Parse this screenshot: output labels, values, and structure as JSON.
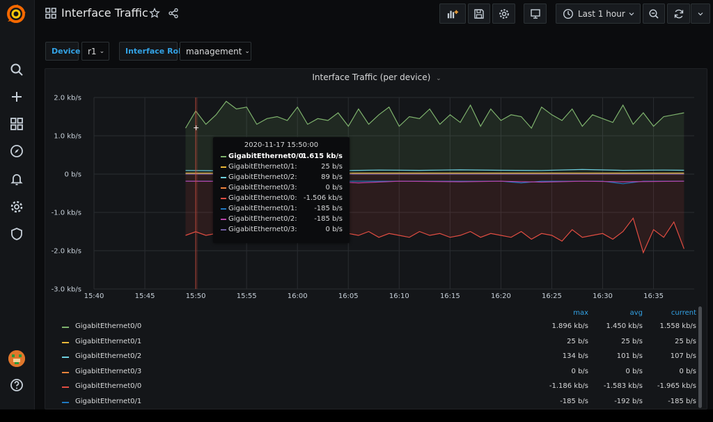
{
  "topbar": {
    "title": "Interface Traffic",
    "time_range": "Last 1 hour"
  },
  "variables": [
    {
      "label": "Device",
      "value": "r1"
    },
    {
      "label": "Interface Role",
      "value": "management"
    }
  ],
  "panel": {
    "title": "Interface Traffic (per device)"
  },
  "chart_data": {
    "type": "line",
    "title": "Interface Traffic (per device)",
    "unit": "b/s",
    "y_ticks": [
      "2.0 kb/s",
      "1.0 kb/s",
      "0 b/s",
      "-1.0 kb/s",
      "-2.0 kb/s",
      "-3.0 kb/s"
    ],
    "ylim": [
      -3000,
      2000
    ],
    "x_ticks": [
      "15:40",
      "15:45",
      "15:50",
      "15:55",
      "16:00",
      "16:05",
      "16:10",
      "16:15",
      "16:20",
      "16:25",
      "16:30",
      "16:35"
    ],
    "x_tick_minutes": [
      0,
      5,
      10,
      15,
      20,
      25,
      30,
      35,
      40,
      45,
      50,
      55
    ],
    "xlim_minutes": [
      0,
      59
    ],
    "x_start_label": "15:40",
    "grid": true,
    "series": [
      {
        "name": "GigabitEthernet0/0",
        "color": "#7eb26d",
        "fill": true,
        "x": [
          9,
          10,
          11,
          12,
          13,
          14,
          15,
          16,
          17,
          18,
          19,
          20,
          21,
          22,
          23,
          24,
          25,
          26,
          27,
          28,
          29,
          30,
          31,
          32,
          33,
          34,
          35,
          36,
          37,
          38,
          39,
          40,
          41,
          42,
          43,
          44,
          45,
          46,
          47,
          48,
          49,
          50,
          51,
          52,
          53,
          54,
          55,
          56,
          57,
          58
        ],
        "values": [
          1200,
          1650,
          1300,
          1550,
          1900,
          1700,
          1750,
          1300,
          1450,
          1500,
          1400,
          1750,
          1300,
          1450,
          1400,
          1600,
          1250,
          1700,
          1300,
          1550,
          1750,
          1250,
          1500,
          1450,
          1700,
          1300,
          1550,
          1350,
          1800,
          1250,
          1700,
          1400,
          1550,
          1500,
          1200,
          1750,
          1550,
          1400,
          1700,
          1250,
          1550,
          1450,
          1350,
          1800,
          1300,
          1600,
          1250,
          1500,
          1550,
          1600
        ]
      },
      {
        "name": "GigabitEthernet0/1",
        "color": "#eab839",
        "fill": false,
        "x": [
          9,
          58
        ],
        "values": [
          25,
          25
        ]
      },
      {
        "name": "GigabitEthernet0/2",
        "color": "#6ed0e0",
        "fill": false,
        "x": [
          9,
          12,
          16,
          20,
          24,
          28,
          32,
          36,
          40,
          44,
          48,
          52,
          56,
          58
        ],
        "values": [
          95,
          89,
          110,
          100,
          90,
          105,
          98,
          110,
          100,
          95,
          120,
          98,
          105,
          100
        ]
      },
      {
        "name": "GigabitEthernet0/3",
        "color": "#ef843c",
        "fill": false,
        "x": [
          9,
          58
        ],
        "values": [
          0,
          0
        ]
      },
      {
        "name": "GigabitEthernet0/0",
        "color": "#e24d42",
        "fill": true,
        "x": [
          9,
          10,
          11,
          12,
          13,
          14,
          15,
          16,
          17,
          18,
          19,
          20,
          21,
          22,
          23,
          24,
          25,
          26,
          27,
          28,
          29,
          30,
          31,
          32,
          33,
          34,
          35,
          36,
          37,
          38,
          39,
          40,
          41,
          42,
          43,
          44,
          45,
          46,
          47,
          48,
          49,
          50,
          51,
          52,
          53,
          54,
          55,
          56,
          57,
          58
        ],
        "values": [
          -1600,
          -1506,
          -1600,
          -1550,
          -1650,
          -1500,
          -1600,
          -1550,
          -1700,
          -1450,
          -1600,
          -1550,
          -1650,
          -1500,
          -1600,
          -1650,
          -1550,
          -1600,
          -1500,
          -1650,
          -1550,
          -1600,
          -1650,
          -1500,
          -1600,
          -1550,
          -1650,
          -1600,
          -1500,
          -1650,
          -1550,
          -1600,
          -1650,
          -1500,
          -1700,
          -1550,
          -1600,
          -1750,
          -1450,
          -1650,
          -1600,
          -1550,
          -1700,
          -1500,
          -1150,
          -2050,
          -1450,
          -1650,
          -1250,
          -1950
        ]
      },
      {
        "name": "GigabitEthernet0/1",
        "color": "#1f78c1",
        "fill": false,
        "x": [
          9,
          20,
          30,
          40,
          42,
          44,
          50,
          52,
          54,
          58
        ],
        "values": [
          -185,
          -185,
          -185,
          -185,
          -230,
          -185,
          -185,
          -250,
          -185,
          -185
        ]
      },
      {
        "name": "GigabitEthernet0/2",
        "color": "#ba43a9",
        "fill": false,
        "x": [
          9,
          18,
          22,
          26,
          30,
          36,
          40,
          44,
          48,
          52,
          58
        ],
        "values": [
          -185,
          -200,
          -185,
          -230,
          -185,
          -200,
          -185,
          -210,
          -185,
          -200,
          -185
        ]
      },
      {
        "name": "GigabitEthernet0/3",
        "color": "#705da0",
        "fill": false,
        "x": [
          9,
          58
        ],
        "values": [
          0,
          0
        ]
      }
    ],
    "crosshair_minute": 10
  },
  "tooltip": {
    "time": "2020-11-17 15:50:00",
    "rows": [
      {
        "name": "GigabitEthernet0/0:",
        "value": "1.615 kb/s",
        "color": "#7eb26d"
      },
      {
        "name": "GigabitEthernet0/1:",
        "value": "25 b/s",
        "color": "#eab839"
      },
      {
        "name": "GigabitEthernet0/2:",
        "value": "89 b/s",
        "color": "#6ed0e0"
      },
      {
        "name": "GigabitEthernet0/3:",
        "value": "0 b/s",
        "color": "#ef843c"
      },
      {
        "name": "GigabitEthernet0/0:",
        "value": "-1.506 kb/s",
        "color": "#e24d42"
      },
      {
        "name": "GigabitEthernet0/1:",
        "value": "-185 b/s",
        "color": "#1f78c1"
      },
      {
        "name": "GigabitEthernet0/2:",
        "value": "-185 b/s",
        "color": "#ba43a9"
      },
      {
        "name": "GigabitEthernet0/3:",
        "value": "0 b/s",
        "color": "#705da0"
      }
    ]
  },
  "legend": {
    "headers": {
      "max": "max",
      "avg": "avg",
      "current": "current"
    },
    "rows": [
      {
        "name": "GigabitEthernet0/0",
        "color": "#7eb26d",
        "max": "1.896 kb/s",
        "avg": "1.450 kb/s",
        "current": "1.558 kb/s"
      },
      {
        "name": "GigabitEthernet0/1",
        "color": "#eab839",
        "max": "25 b/s",
        "avg": "25 b/s",
        "current": "25 b/s"
      },
      {
        "name": "GigabitEthernet0/2",
        "color": "#6ed0e0",
        "max": "134 b/s",
        "avg": "101 b/s",
        "current": "107 b/s"
      },
      {
        "name": "GigabitEthernet0/3",
        "color": "#ef843c",
        "max": "0 b/s",
        "avg": "0 b/s",
        "current": "0 b/s"
      },
      {
        "name": "GigabitEthernet0/0",
        "color": "#e24d42",
        "max": "-1.186 kb/s",
        "avg": "-1.583 kb/s",
        "current": "-1.965 kb/s"
      },
      {
        "name": "GigabitEthernet0/1",
        "color": "#1f78c1",
        "max": "-185 b/s",
        "avg": "-192 b/s",
        "current": "-185 b/s"
      }
    ]
  }
}
